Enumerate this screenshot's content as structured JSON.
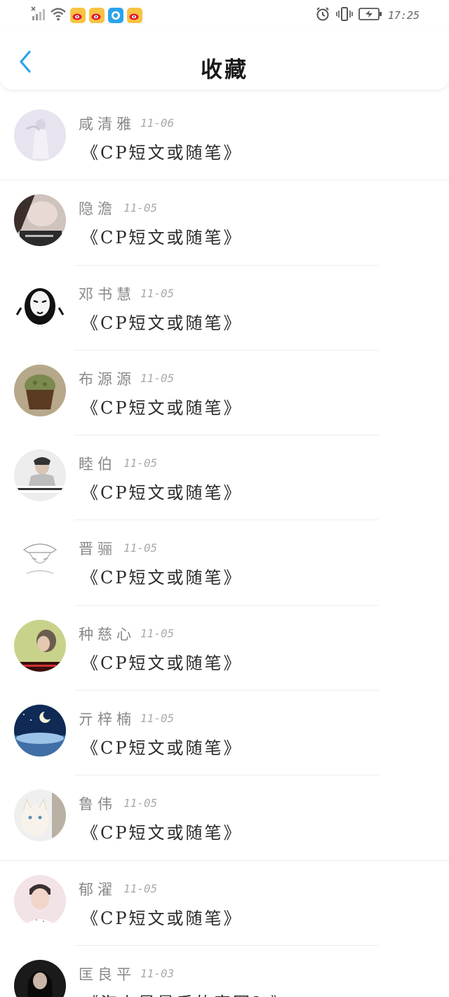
{
  "status_bar": {
    "time": "17:25",
    "left_icons": [
      "no-sim-icon",
      "wifi-icon",
      "weibo-icon",
      "weibo-icon",
      "qq-icon",
      "weibo-icon"
    ],
    "right_icons": [
      "alarm-icon",
      "vibrate-icon",
      "battery-icon"
    ]
  },
  "header": {
    "title": "收藏",
    "back_icon": "chevron-left-icon"
  },
  "colors": {
    "accent": "#2aa3ec",
    "weibo_badge": "#f6c343",
    "name_text": "#888888",
    "date_text": "#aaaaaa",
    "title_text": "#2b2b2b"
  },
  "favorites": [
    {
      "name": "咸清雅",
      "date": "11-06",
      "title": "《CP短文或随笔》"
    },
    {
      "name": "隐澹",
      "date": "11-05",
      "title": "《CP短文或随笔》"
    },
    {
      "name": "邓书慧",
      "date": "11-05",
      "title": "《CP短文或随笔》"
    },
    {
      "name": "布源源",
      "date": "11-05",
      "title": "《CP短文或随笔》"
    },
    {
      "name": "睦伯",
      "date": "11-05",
      "title": "《CP短文或随笔》"
    },
    {
      "name": "晋骊",
      "date": "11-05",
      "title": "《CP短文或随笔》"
    },
    {
      "name": "种慈心",
      "date": "11-05",
      "title": "《CP短文或随笔》"
    },
    {
      "name": "亓梓楠",
      "date": "11-05",
      "title": "《CP短文或随笔》"
    },
    {
      "name": "鲁伟",
      "date": "11-05",
      "title": "《CP短文或随笔》"
    },
    {
      "name": "郁濯",
      "date": "11-05",
      "title": "《CP短文或随笔》"
    },
    {
      "name": "匡良平",
      "date": "11-03",
      "title": "《海上是最后的家园？》"
    }
  ]
}
